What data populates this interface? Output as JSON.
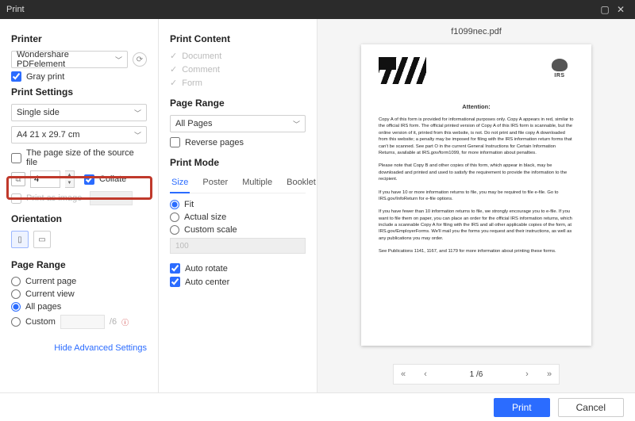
{
  "titlebar": {
    "title": "Print"
  },
  "col1": {
    "printer_heading": "Printer",
    "printer_name": "Wondershare PDFelement",
    "gray_print": "Gray print",
    "settings_heading": "Print Settings",
    "sides": "Single side",
    "paper": "A4 21 x 29.7 cm",
    "page_size_source": "The page size of the source file",
    "copies_value": "4",
    "collate": "Collate",
    "print_as_image": "Print as image",
    "orientation_heading": "Orientation",
    "page_range_heading": "Page Range",
    "current_page": "Current page",
    "current_view": "Current view",
    "all_pages": "All pages",
    "custom": "Custom",
    "custom_total": "/6",
    "hide_advanced": "Hide Advanced Settings"
  },
  "col2": {
    "content_heading": "Print Content",
    "doc": "Document",
    "comment": "Comment",
    "form": "Form",
    "range_heading": "Page Range",
    "all_pages": "All Pages",
    "reverse": "Reverse pages",
    "mode_heading": "Print Mode",
    "tabs": {
      "size": "Size",
      "poster": "Poster",
      "multiple": "Multiple",
      "booklet": "Booklet"
    },
    "fit": "Fit",
    "actual": "Actual size",
    "custom_scale": "Custom scale",
    "scale_value": "100",
    "auto_rotate": "Auto rotate",
    "auto_center": "Auto center"
  },
  "preview": {
    "filename": "f1099nec.pdf",
    "attention": "Attention:",
    "para1": "Copy A of this form is provided for informational purposes only. Copy A appears in red, similar to the official IRS form. The official printed version of Copy A of this IRS form is scannable, but the online version of it, printed from this website, is not. Do not print and file copy A downloaded from this website; a penalty may be imposed for filing with the IRS information return forms that can't be scanned. See part O in the current General Instructions for Certain Information Returns, available at IRS.gov/form1099, for more information about penalties.",
    "para2": "Please note that Copy B and other copies of this form, which appear in black, may be downloaded and printed and used to satisfy the requirement to provide the information to the recipient.",
    "para3": "If you have 10 or more information returns to file, you may be required to file e-file. Go to IRS.gov/InfoReturn for e-file options.",
    "para4": "If you have fewer than 10 information returns to file, we strongly encourage you to e-file. If you want to file them on paper, you can place an order for the official IRS information returns, which include a scannable Copy A for filing with the IRS and all other applicable copies of the form, at IRS.gov/EmployerForms. We'll mail you the forms you request and their instructions, as well as any publications you may order.",
    "para5": "See Publications 1141, 1167, and 1179 for more information about printing these forms.",
    "irs_label": "IRS",
    "pager_display": "1 /6"
  },
  "footer": {
    "print": "Print",
    "cancel": "Cancel"
  }
}
